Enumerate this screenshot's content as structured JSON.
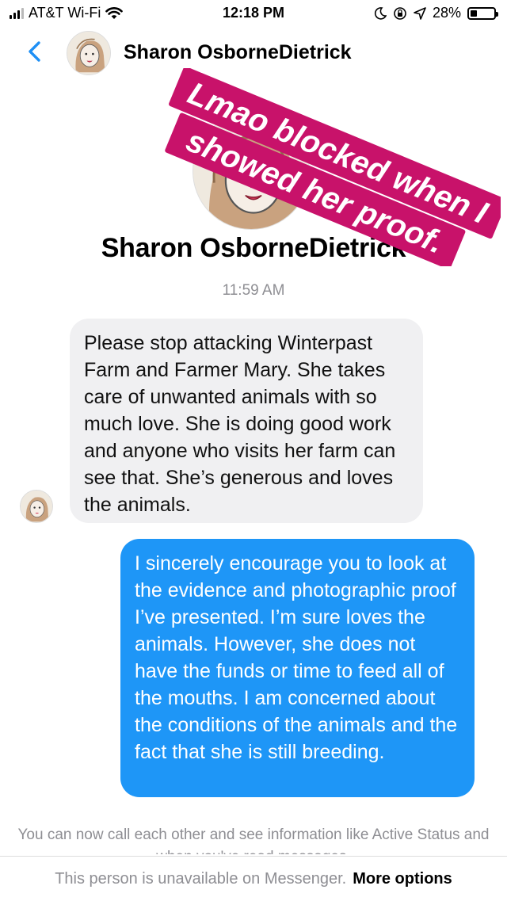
{
  "status_bar": {
    "carrier": "AT&T Wi-Fi",
    "time": "12:18 PM",
    "battery_percent": "28%",
    "battery_level": 0.28,
    "icons": [
      "signal-icon",
      "wifi-icon",
      "moon-icon",
      "rotation-lock-icon",
      "location-arrow-icon",
      "battery-icon"
    ]
  },
  "header": {
    "contact_name": "Sharon OsborneDietrick",
    "back_icon": "chevron-left-icon"
  },
  "profile": {
    "name": "Sharon OsborneDietrick"
  },
  "sticker": {
    "line1": "Lmao blocked when I",
    "line2": "showed her proof.",
    "background_color": "#c8126a",
    "text_color": "#ffffff"
  },
  "conversation": {
    "timestamp": "11:59 AM",
    "incoming_message": "Please stop attacking Winterpast Farm and Farmer Mary.  She takes care of unwanted animals with so much  love.  She is doing good work and anyone who visits her farm can see that.  She’s generous and loves the animals.",
    "outgoing_message": "I sincerely encourage you to look at the evidence and photographic proof I’ve presented. I’m sure loves the animals. However, she does not have the funds or time to feed all of the mouths. I am concerned about the conditions of the animals and the fact that she is still breeding.",
    "incoming_color": "#f0f0f2",
    "outgoing_color": "#1e96f7"
  },
  "footer": {
    "info_note": "You can now call each other and see information like Active Status and when you've read messages.",
    "unavailable_text": "This person is unavailable on Messenger.",
    "more_options": "More options"
  },
  "accent_color": "#1e8ff5"
}
